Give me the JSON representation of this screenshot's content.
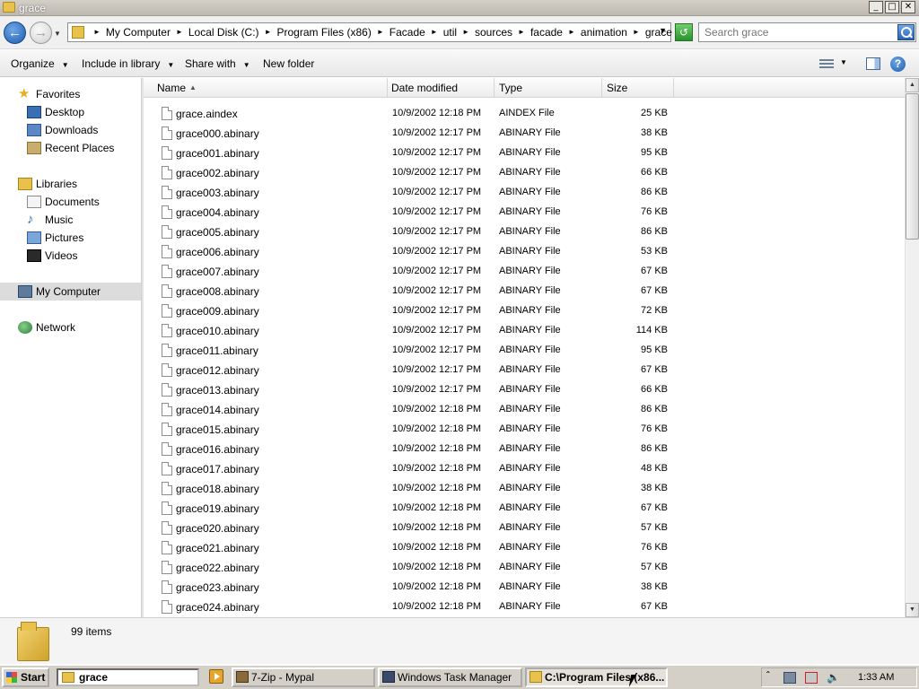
{
  "window": {
    "title": "grace",
    "controls": {
      "minimize": "_",
      "maximize": "□",
      "close": "✕"
    }
  },
  "address": {
    "breadcrumbs": [
      "My Computer",
      "Local Disk (C:)",
      "Program Files (x86)",
      "Facade",
      "util",
      "sources",
      "facade",
      "animation",
      "grace"
    ],
    "search_placeholder": "Search grace"
  },
  "toolbar": {
    "organize": "Organize",
    "include_in_library": "Include in library",
    "share_with": "Share with",
    "new_folder": "New folder"
  },
  "navigation": {
    "favorites": {
      "label": "Favorites",
      "items": [
        "Desktop",
        "Downloads",
        "Recent Places"
      ]
    },
    "libraries": {
      "label": "Libraries",
      "items": [
        "Documents",
        "Music",
        "Pictures",
        "Videos"
      ]
    },
    "computer": "My Computer",
    "network": "Network"
  },
  "columns": {
    "name": "Name",
    "date_modified": "Date modified",
    "type": "Type",
    "size": "Size"
  },
  "files": [
    {
      "name": "grace.aindex",
      "date": "10/9/2002 12:18 PM",
      "type": "AINDEX File",
      "size": "25 KB"
    },
    {
      "name": "grace000.abinary",
      "date": "10/9/2002 12:17 PM",
      "type": "ABINARY File",
      "size": "38 KB"
    },
    {
      "name": "grace001.abinary",
      "date": "10/9/2002 12:17 PM",
      "type": "ABINARY File",
      "size": "95 KB"
    },
    {
      "name": "grace002.abinary",
      "date": "10/9/2002 12:17 PM",
      "type": "ABINARY File",
      "size": "66 KB"
    },
    {
      "name": "grace003.abinary",
      "date": "10/9/2002 12:17 PM",
      "type": "ABINARY File",
      "size": "86 KB"
    },
    {
      "name": "grace004.abinary",
      "date": "10/9/2002 12:17 PM",
      "type": "ABINARY File",
      "size": "76 KB"
    },
    {
      "name": "grace005.abinary",
      "date": "10/9/2002 12:17 PM",
      "type": "ABINARY File",
      "size": "86 KB"
    },
    {
      "name": "grace006.abinary",
      "date": "10/9/2002 12:17 PM",
      "type": "ABINARY File",
      "size": "53 KB"
    },
    {
      "name": "grace007.abinary",
      "date": "10/9/2002 12:17 PM",
      "type": "ABINARY File",
      "size": "67 KB"
    },
    {
      "name": "grace008.abinary",
      "date": "10/9/2002 12:17 PM",
      "type": "ABINARY File",
      "size": "67 KB"
    },
    {
      "name": "grace009.abinary",
      "date": "10/9/2002 12:17 PM",
      "type": "ABINARY File",
      "size": "72 KB"
    },
    {
      "name": "grace010.abinary",
      "date": "10/9/2002 12:17 PM",
      "type": "ABINARY File",
      "size": "114 KB"
    },
    {
      "name": "grace011.abinary",
      "date": "10/9/2002 12:17 PM",
      "type": "ABINARY File",
      "size": "95 KB"
    },
    {
      "name": "grace012.abinary",
      "date": "10/9/2002 12:17 PM",
      "type": "ABINARY File",
      "size": "67 KB"
    },
    {
      "name": "grace013.abinary",
      "date": "10/9/2002 12:17 PM",
      "type": "ABINARY File",
      "size": "66 KB"
    },
    {
      "name": "grace014.abinary",
      "date": "10/9/2002 12:18 PM",
      "type": "ABINARY File",
      "size": "86 KB"
    },
    {
      "name": "grace015.abinary",
      "date": "10/9/2002 12:18 PM",
      "type": "ABINARY File",
      "size": "76 KB"
    },
    {
      "name": "grace016.abinary",
      "date": "10/9/2002 12:18 PM",
      "type": "ABINARY File",
      "size": "86 KB"
    },
    {
      "name": "grace017.abinary",
      "date": "10/9/2002 12:18 PM",
      "type": "ABINARY File",
      "size": "48 KB"
    },
    {
      "name": "grace018.abinary",
      "date": "10/9/2002 12:18 PM",
      "type": "ABINARY File",
      "size": "38 KB"
    },
    {
      "name": "grace019.abinary",
      "date": "10/9/2002 12:18 PM",
      "type": "ABINARY File",
      "size": "67 KB"
    },
    {
      "name": "grace020.abinary",
      "date": "10/9/2002 12:18 PM",
      "type": "ABINARY File",
      "size": "57 KB"
    },
    {
      "name": "grace021.abinary",
      "date": "10/9/2002 12:18 PM",
      "type": "ABINARY File",
      "size": "76 KB"
    },
    {
      "name": "grace022.abinary",
      "date": "10/9/2002 12:18 PM",
      "type": "ABINARY File",
      "size": "57 KB"
    },
    {
      "name": "grace023.abinary",
      "date": "10/9/2002 12:18 PM",
      "type": "ABINARY File",
      "size": "38 KB"
    },
    {
      "name": "grace024.abinary",
      "date": "10/9/2002 12:18 PM",
      "type": "ABINARY File",
      "size": "67 KB"
    }
  ],
  "details": {
    "item_count": "99 items"
  },
  "taskbar": {
    "start": "Start",
    "address_text": "grace",
    "tasks": [
      "7-Zip - Mypal",
      "Windows Task Manager",
      "C:\\Program Files (x86..."
    ],
    "clock": "1:33 AM"
  },
  "icons": {
    "nav_back": "arrow-left-icon",
    "nav_forward": "arrow-right-icon",
    "search": "magnifier-icon",
    "folder": "folder-icon",
    "file": "generic-file-icon"
  },
  "colors": {
    "accent": "#1d5bb0",
    "selection": "#dcdcdc",
    "folder": "#e8c24a"
  }
}
